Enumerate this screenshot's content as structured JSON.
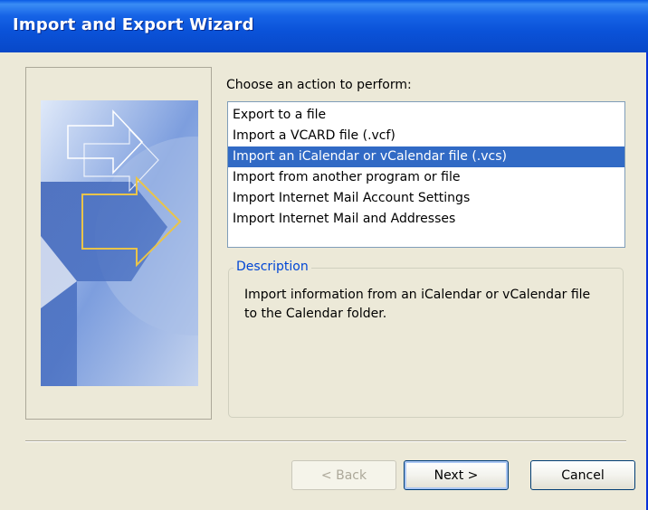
{
  "window": {
    "title": "Import and Export Wizard"
  },
  "main": {
    "prompt": "Choose an action to perform:",
    "actions": [
      "Export to a file",
      "Import a VCARD file (.vcf)",
      "Import an iCalendar or vCalendar file (.vcs)",
      "Import from another program or file",
      "Import Internet Mail Account Settings",
      "Import Internet Mail and Addresses"
    ],
    "selected_action": "Import an iCalendar or vCalendar file (.vcs)",
    "description_label": "Description",
    "description": "Import information from an iCalendar or vCalendar file to the Calendar folder."
  },
  "buttons": {
    "back": "< Back",
    "next": "Next >",
    "cancel": "Cancel"
  },
  "colors": {
    "titlebar": "#0a52d8",
    "selection": "#316ac5",
    "legend_text": "#0046d5",
    "dialog_bg": "#ece9d8"
  }
}
